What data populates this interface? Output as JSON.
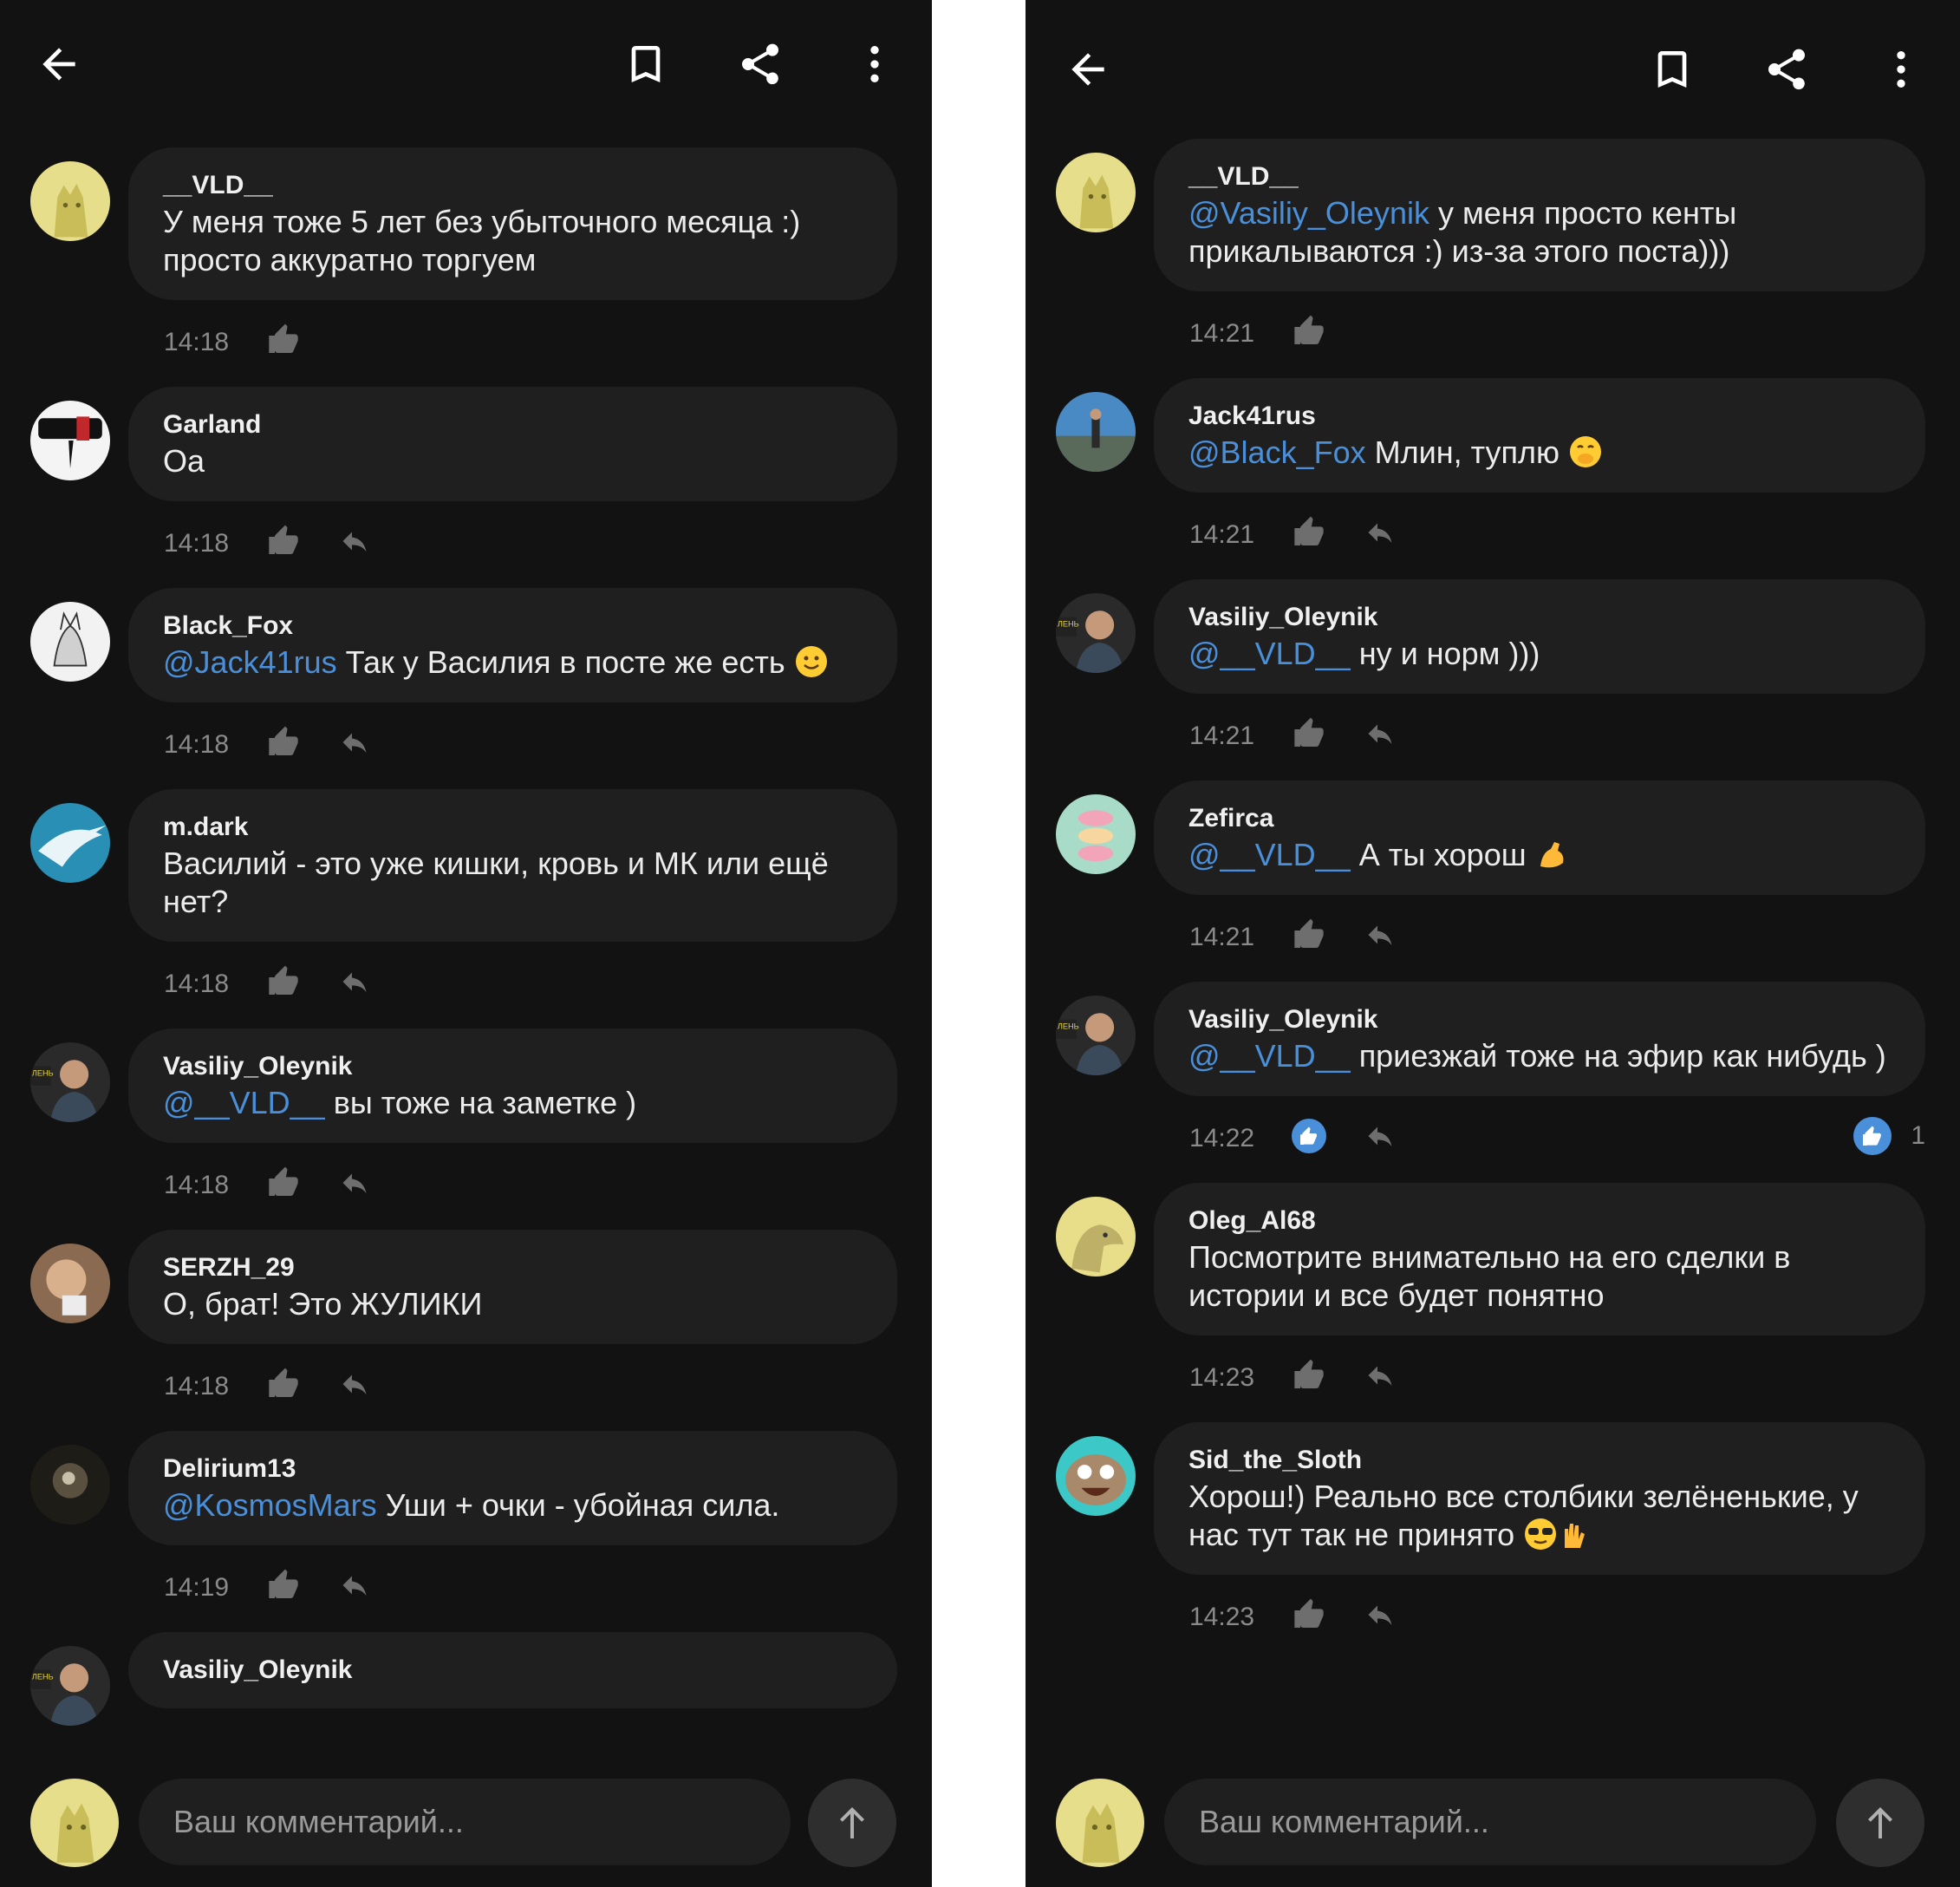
{
  "colors": {
    "background": "#121212",
    "bubble": "#1f1f1f",
    "mention": "#4a8fd9",
    "like_active": "#4a8fd9",
    "meta": "#8a8a8a"
  },
  "left": {
    "comments": [
      {
        "author": "__VLD__",
        "mention": "",
        "text": "У меня тоже 5 лет без убыточного месяца :) просто аккуратно торгуем",
        "time": "14:18",
        "avatar": "avatar-cat-yellow",
        "reply": false
      },
      {
        "author": "Garland",
        "mention": "",
        "text": "Оа",
        "time": "14:18",
        "avatar": "avatar-garland",
        "reply": true
      },
      {
        "author": "Black_Fox",
        "mention": "@Jack41rus",
        "text": "Так у Василия в посте же есть",
        "emoji": "slight-smile",
        "time": "14:18",
        "avatar": "avatar-fox",
        "reply": true
      },
      {
        "author": "m.dark",
        "mention": "",
        "text": "Василий - это уже кишки, кровь и МК или ещё нет?",
        "time": "14:18",
        "avatar": "avatar-bird",
        "reply": true
      },
      {
        "author": "Vasiliy_Oleynik",
        "mention": "@__VLD__",
        "text": "вы тоже на заметке )",
        "time": "14:18",
        "avatar": "avatar-man",
        "reply": true
      },
      {
        "author": "SERZH_29",
        "mention": "",
        "text": "О, брат! Это ЖУЛИКИ",
        "time": "14:18",
        "avatar": "avatar-cat-photo",
        "reply": true
      },
      {
        "author": "Delirium13",
        "mention": "@KosmosMars",
        "text": "Уши + очки  - убойная сила.",
        "time": "14:19",
        "avatar": "avatar-dark",
        "reply": true
      },
      {
        "author": "Vasiliy_Oleynik",
        "mention": "",
        "text": "",
        "time": "",
        "avatar": "avatar-man",
        "reply": true,
        "partial": true
      }
    ],
    "input_placeholder": "Ваш комментарий..."
  },
  "right": {
    "comments": [
      {
        "author": "__VLD__",
        "mention": "@Vasiliy_Oleynik",
        "text": "у меня просто кенты прикалываются :) из-за этого поста)))",
        "time": "14:21",
        "avatar": "avatar-cat-yellow",
        "reply": false
      },
      {
        "author": "Jack41rus",
        "mention": "@Black_Fox",
        "text": "Млин, туплю",
        "emoji": "hand-over-mouth",
        "time": "14:21",
        "avatar": "avatar-jack",
        "reply": true
      },
      {
        "author": "Vasiliy_Oleynik",
        "mention": "@__VLD__",
        "text": "ну и норм )))",
        "time": "14:21",
        "avatar": "avatar-man",
        "reply": true
      },
      {
        "author": "Zefirca",
        "mention": "@__VLD__",
        "text": "А ты хорош",
        "emoji": "flexed-biceps",
        "time": "14:21",
        "avatar": "avatar-macarons",
        "reply": true
      },
      {
        "author": "Vasiliy_Oleynik",
        "mention": "@__VLD__",
        "text": "приезжай тоже на эфир как нибудь )",
        "time": "14:22",
        "avatar": "avatar-man",
        "reply": true,
        "liked": true,
        "like_count": "1"
      },
      {
        "author": "Oleg_Al68",
        "mention": "",
        "text": "Посмотрите внимательно на его сделки в истории и все будет понятно",
        "time": "14:23",
        "avatar": "avatar-seal",
        "reply": true
      },
      {
        "author": "Sid_the_Sloth",
        "mention": "",
        "text": "Хорош!) Реально все столбики зелёненькие, у нас тут так не принято",
        "emoji": "sunglasses-hand",
        "time": "14:23",
        "avatar": "avatar-sloth",
        "reply": true
      }
    ],
    "input_placeholder": "Ваш комментарий..."
  }
}
